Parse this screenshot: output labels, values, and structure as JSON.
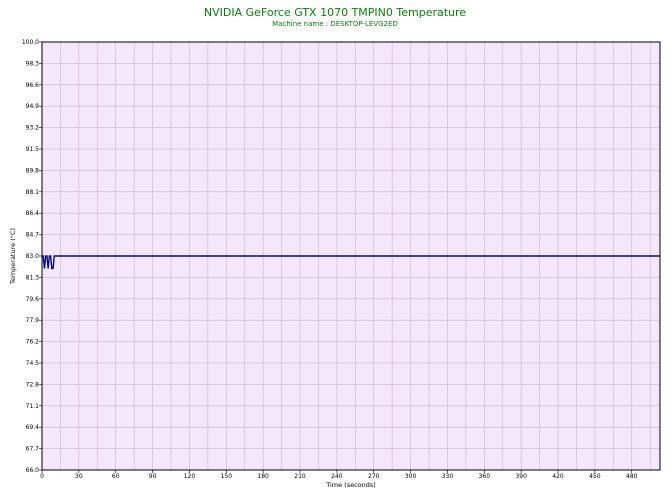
{
  "title": "NVIDIA GeForce GTX 1070 TMPIN0 Temperature",
  "subtitle": "Machine name : DESKTOP-LEVG2ED",
  "colors": {
    "title": "#127a12",
    "plot_background": "#f4e6fb",
    "grid": "#c9b6cf",
    "line": "#0a0a80"
  },
  "chart_data": {
    "type": "line",
    "title": "NVIDIA GeForce GTX 1070 TMPIN0 Temperature",
    "subtitle": "Machine name : DESKTOP-LEVG2ED",
    "xlabel": "Time (seconds)",
    "ylabel": "Temperature (°C)",
    "xlim": [
      0,
      503
    ],
    "ylim": [
      66.0,
      100.0
    ],
    "x_ticks": [
      "0",
      "30",
      "60",
      "90",
      "120",
      "150",
      "180",
      "210",
      "240",
      "270",
      "300",
      "330",
      "360",
      "390",
      "420",
      "450",
      "480"
    ],
    "y_ticks": [
      "100.0",
      "98.3",
      "96.6",
      "94.9",
      "93.2",
      "91.5",
      "89.8",
      "88.1",
      "86.4",
      "84.7",
      "83.0",
      "81.3",
      "79.6",
      "77.9",
      "76.2",
      "74.5",
      "72.8",
      "71.1",
      "69.4",
      "67.7",
      "66.0"
    ],
    "grid": true,
    "series": [
      {
        "x": [
          0,
          1,
          2,
          3,
          4,
          5,
          6,
          7,
          8,
          9,
          10,
          11,
          503
        ],
        "y": [
          83,
          83,
          82,
          83,
          83,
          82,
          83,
          83,
          82,
          82,
          83,
          83,
          83
        ]
      }
    ]
  }
}
